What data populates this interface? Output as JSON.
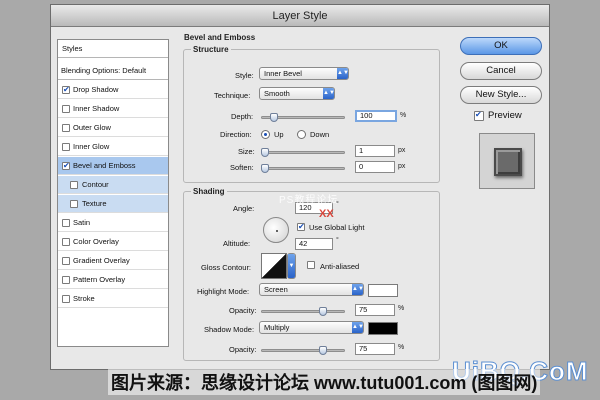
{
  "window": {
    "title": "Layer Style"
  },
  "sidebar": {
    "header": "Styles",
    "items": [
      {
        "label": "Blending Options: Default",
        "checkbox": false
      },
      {
        "label": "Drop Shadow",
        "checkbox": true,
        "checked": true
      },
      {
        "label": "Inner Shadow",
        "checkbox": true,
        "checked": false
      },
      {
        "label": "Outer Glow",
        "checkbox": true,
        "checked": false
      },
      {
        "label": "Inner Glow",
        "checkbox": true,
        "checked": false
      },
      {
        "label": "Bevel and Emboss",
        "checkbox": true,
        "checked": true,
        "selected": true
      },
      {
        "label": "Contour",
        "checkbox": true,
        "checked": false,
        "sub": true
      },
      {
        "label": "Texture",
        "checkbox": true,
        "checked": false,
        "sub": true
      },
      {
        "label": "Satin",
        "checkbox": true,
        "checked": false
      },
      {
        "label": "Color Overlay",
        "checkbox": true,
        "checked": false
      },
      {
        "label": "Gradient Overlay",
        "checkbox": true,
        "checked": false
      },
      {
        "label": "Pattern Overlay",
        "checkbox": true,
        "checked": false
      },
      {
        "label": "Stroke",
        "checkbox": true,
        "checked": false
      }
    ]
  },
  "bevel": {
    "title": "Bevel and Emboss",
    "structure": {
      "title": "Structure",
      "style_label": "Style:",
      "style_value": "Inner Bevel",
      "technique_label": "Technique:",
      "technique_value": "Smooth",
      "depth_label": "Depth:",
      "depth_value": "100",
      "depth_unit": "%",
      "direction_label": "Direction:",
      "dir_up": "Up",
      "dir_down": "Down",
      "size_label": "Size:",
      "size_value": "1",
      "size_unit": "px",
      "soften_label": "Soften:",
      "soften_value": "0",
      "soften_unit": "px"
    },
    "shading": {
      "title": "Shading",
      "angle_label": "Angle:",
      "angle_value": "120",
      "angle_unit": "°",
      "global_light_label": "Use Global Light",
      "altitude_label": "Altitude:",
      "altitude_value": "42",
      "altitude_unit": "°",
      "gloss_label": "Gloss Contour:",
      "anti_aliased_label": "Anti-aliased",
      "highlight_label": "Highlight Mode:",
      "highlight_value": "Screen",
      "highlight_color": "#ffffff",
      "hl_opacity_label": "Opacity:",
      "hl_opacity_value": "75",
      "hl_opacity_unit": "%",
      "shadow_label": "Shadow Mode:",
      "shadow_value": "Multiply",
      "shadow_color": "#000000",
      "sh_opacity_label": "Opacity:",
      "sh_opacity_value": "75",
      "sh_opacity_unit": "%"
    }
  },
  "buttons": {
    "ok": "OK",
    "cancel": "Cancel",
    "new_style": "New Style...",
    "preview": "Preview"
  },
  "watermarks": {
    "center": "PS教程论坛",
    "red": "XX",
    "right": "UiBQ.CoM",
    "caption": "图片来源：思缘设计论坛 www.tutu001.com (图图网)"
  }
}
